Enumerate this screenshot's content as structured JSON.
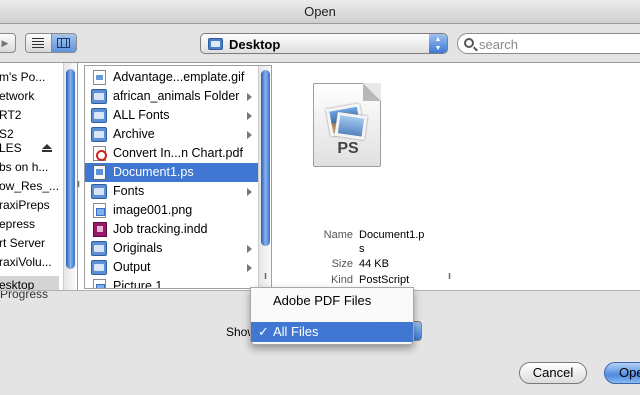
{
  "window": {
    "title": "Open"
  },
  "toolbar": {
    "location": "Desktop",
    "search_placeholder": "search"
  },
  "sidebar": {
    "items": [
      {
        "label": "m's Po..."
      },
      {
        "label": "etwork"
      },
      {
        "label": "RT2"
      },
      {
        "label": "S2"
      },
      {
        "label": "LES"
      },
      {
        "label": "bs on h..."
      },
      {
        "label": "ow_Res_..."
      },
      {
        "label": "raxiPreps"
      },
      {
        "label": "epress"
      },
      {
        "label": "rt Server"
      },
      {
        "label": "raxiVolu..."
      },
      {
        "label": "esktop"
      },
      {
        "label": "Progress"
      }
    ],
    "selected": "esktop"
  },
  "files": {
    "items": [
      {
        "name": "Advantage...emplate.gif",
        "icon": "doc-icon",
        "folder": false
      },
      {
        "name": "african_animals Folder",
        "icon": "folder-icon",
        "folder": true
      },
      {
        "name": "ALL Fonts",
        "icon": "folder-icon",
        "folder": true
      },
      {
        "name": "Archive",
        "icon": "folder-icon",
        "folder": true
      },
      {
        "name": "Convert In...n Chart.pdf",
        "icon": "pdf-icon",
        "folder": false
      },
      {
        "name": "Document1.ps",
        "icon": "ps-file-icon",
        "folder": false
      },
      {
        "name": "Fonts",
        "icon": "folder-icon",
        "folder": true
      },
      {
        "name": "image001.png",
        "icon": "image-icon",
        "folder": false
      },
      {
        "name": "Job tracking.indd",
        "icon": "indesign-icon",
        "folder": false
      },
      {
        "name": "Originals",
        "icon": "folder-icon",
        "folder": true
      },
      {
        "name": "Output",
        "icon": "folder-icon",
        "folder": true
      },
      {
        "name": "Picture 1",
        "icon": "image-icon",
        "folder": false
      }
    ],
    "selected": "Document1.ps"
  },
  "preview": {
    "icon_label": "PS",
    "name_key": "Name",
    "name_value_1": "Document1.p",
    "name_value_2": "s",
    "size_key": "Size",
    "size_value": "44 KB",
    "kind_key": "Kind",
    "kind_value": "PostScript"
  },
  "bottom": {
    "show_label": "Show",
    "partial_sidebar_label": "Progress",
    "cancel_label": "Cancel",
    "open_label": "Ope"
  },
  "show_menu": {
    "items": [
      "Adobe PDF Files",
      "All Files"
    ],
    "selected": "All Files",
    "check_glyph": "✓"
  },
  "colors": {
    "selection": "#3f77d3",
    "accent": "#5f93d9"
  }
}
